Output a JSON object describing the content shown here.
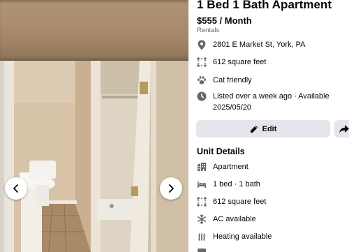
{
  "listing": {
    "title": "1 Bed 1 Bath Apartment",
    "price": "$555 / Month",
    "category": "Rentals",
    "address": "2801 E Market St, York, PA",
    "size": "612 square feet",
    "pets": "Cat friendly",
    "listed": "Listed over a week ago · Available 2025/05/20"
  },
  "actions": {
    "edit_label": "Edit"
  },
  "unit_details": {
    "heading": "Unit Details",
    "items": [
      {
        "icon": "building-icon",
        "label": "Apartment"
      },
      {
        "icon": "bed-icon",
        "label": "1 bed · 1 bath"
      },
      {
        "icon": "square-feet-icon",
        "label": "612 square feet"
      },
      {
        "icon": "snowflake-icon",
        "label": "AC available"
      },
      {
        "icon": "heating-icon",
        "label": "Heating available"
      }
    ]
  },
  "colors": {
    "icon_gray": "#65676b",
    "button_bg": "#e4e6eb",
    "secondary_text": "#65676b"
  }
}
